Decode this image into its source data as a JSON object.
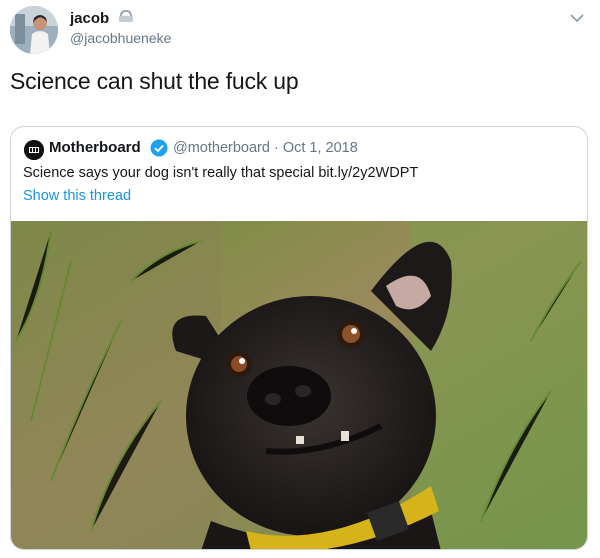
{
  "author": {
    "display_name": "jacob",
    "handle": "@jacobhueneke",
    "avatar_icon": "user-avatar",
    "protected_icon": "lock-icon"
  },
  "tweet": {
    "text": "Science can shut the fuck up",
    "menu_icon": "chevron-down-icon"
  },
  "quoted_tweet": {
    "display_name": "Motherboard",
    "verified_icon": "verified-badge-icon",
    "meta": "@motherboard · Oct 1, 2018",
    "text": "Science says your dog isn't really that special bit.ly/2y2WDPT",
    "show_thread": "Show this thread",
    "image": "black dog looking up from grass with yellow collar"
  },
  "colors": {
    "link": "#1b95e0",
    "secondary_text": "#657786",
    "border": "#ccd6dd",
    "verified": "#1da1f2"
  }
}
